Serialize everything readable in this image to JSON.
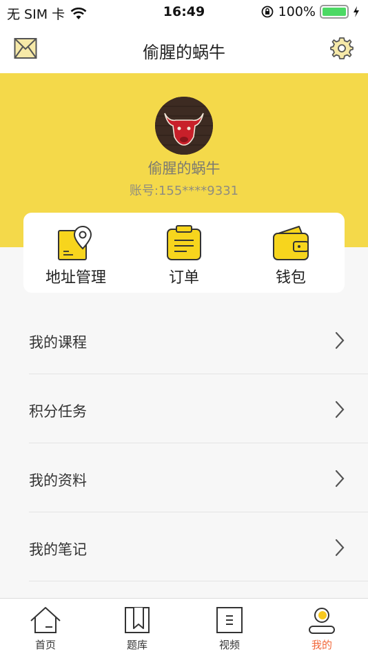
{
  "status_bar": {
    "carrier": "无 SIM 卡",
    "time": "16:49",
    "battery": "100%"
  },
  "nav": {
    "title": "偷腥的蜗牛"
  },
  "profile": {
    "username": "偷腥的蜗牛",
    "account": "账号:155****9331"
  },
  "quick_actions": [
    {
      "label": "地址管理",
      "icon": "location-document-icon"
    },
    {
      "label": "订单",
      "icon": "clipboard-icon"
    },
    {
      "label": "钱包",
      "icon": "wallet-icon"
    }
  ],
  "menu": [
    {
      "label": "我的课程"
    },
    {
      "label": "积分任务"
    },
    {
      "label": "我的资料"
    },
    {
      "label": "我的笔记"
    }
  ],
  "tabs": [
    {
      "label": "首页",
      "icon": "home-icon"
    },
    {
      "label": "题库",
      "icon": "bookmark-book-icon"
    },
    {
      "label": "视频",
      "icon": "video-list-icon"
    },
    {
      "label": "我的",
      "icon": "profile-icon",
      "active": true
    }
  ],
  "colors": {
    "accent_yellow": "#f4d94a",
    "active_tab": "#f2683a",
    "icon_yellow": "#f7d51d"
  }
}
